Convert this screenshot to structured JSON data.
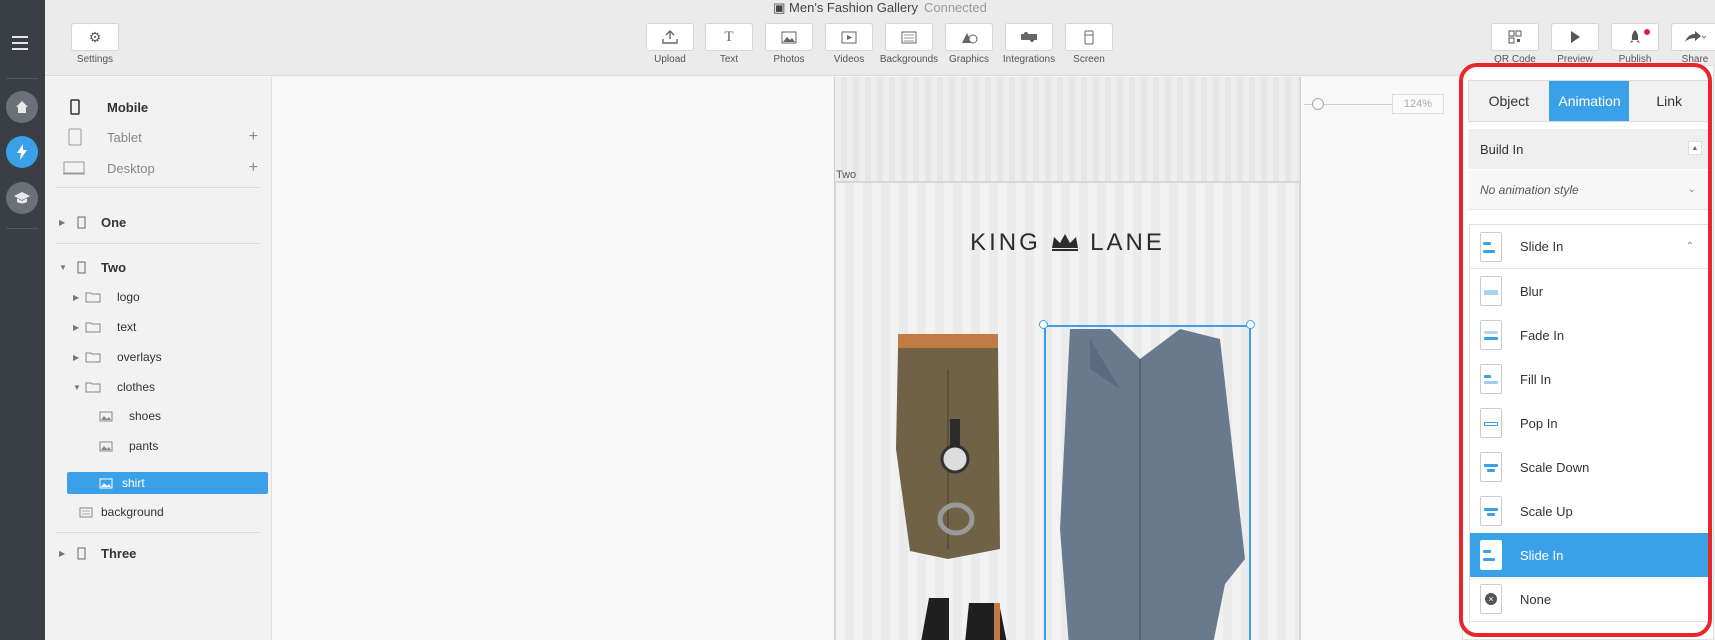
{
  "app": {
    "title": "Men's Fashion Gallery",
    "status": "Connected"
  },
  "toolbar": {
    "settings": "Settings",
    "tools": [
      "Upload",
      "Text",
      "Photos",
      "Videos",
      "Backgrounds",
      "Graphics",
      "Integrations",
      "Screen"
    ],
    "right": [
      "QR Code",
      "Preview",
      "Publish",
      "Share"
    ]
  },
  "devices": {
    "mobile": "Mobile",
    "tablet": "Tablet",
    "desktop": "Desktop"
  },
  "layers": {
    "page_one": "One",
    "page_two": "Two",
    "logo": "logo",
    "text": "text",
    "overlays": "overlays",
    "clothes": "clothes",
    "shoes": "shoes",
    "pants": "pants",
    "shirt": "shirt",
    "background": "background",
    "page_three": "Three"
  },
  "canvas": {
    "zoom": "124%",
    "frame_label": "Two",
    "logo_left": "KING",
    "logo_right": "LANE"
  },
  "panel": {
    "tabs": [
      "Object",
      "Animation",
      "Link"
    ],
    "build_in": "Build In",
    "style_placeholder": "No animation style",
    "current": "Slide In",
    "options": [
      "Blur",
      "Fade In",
      "Fill In",
      "Pop In",
      "Scale Down",
      "Scale Up",
      "Slide In",
      "None"
    ],
    "selected_option": "Slide In",
    "accent": "#3aa0e8",
    "highlight": "#e8262b"
  }
}
